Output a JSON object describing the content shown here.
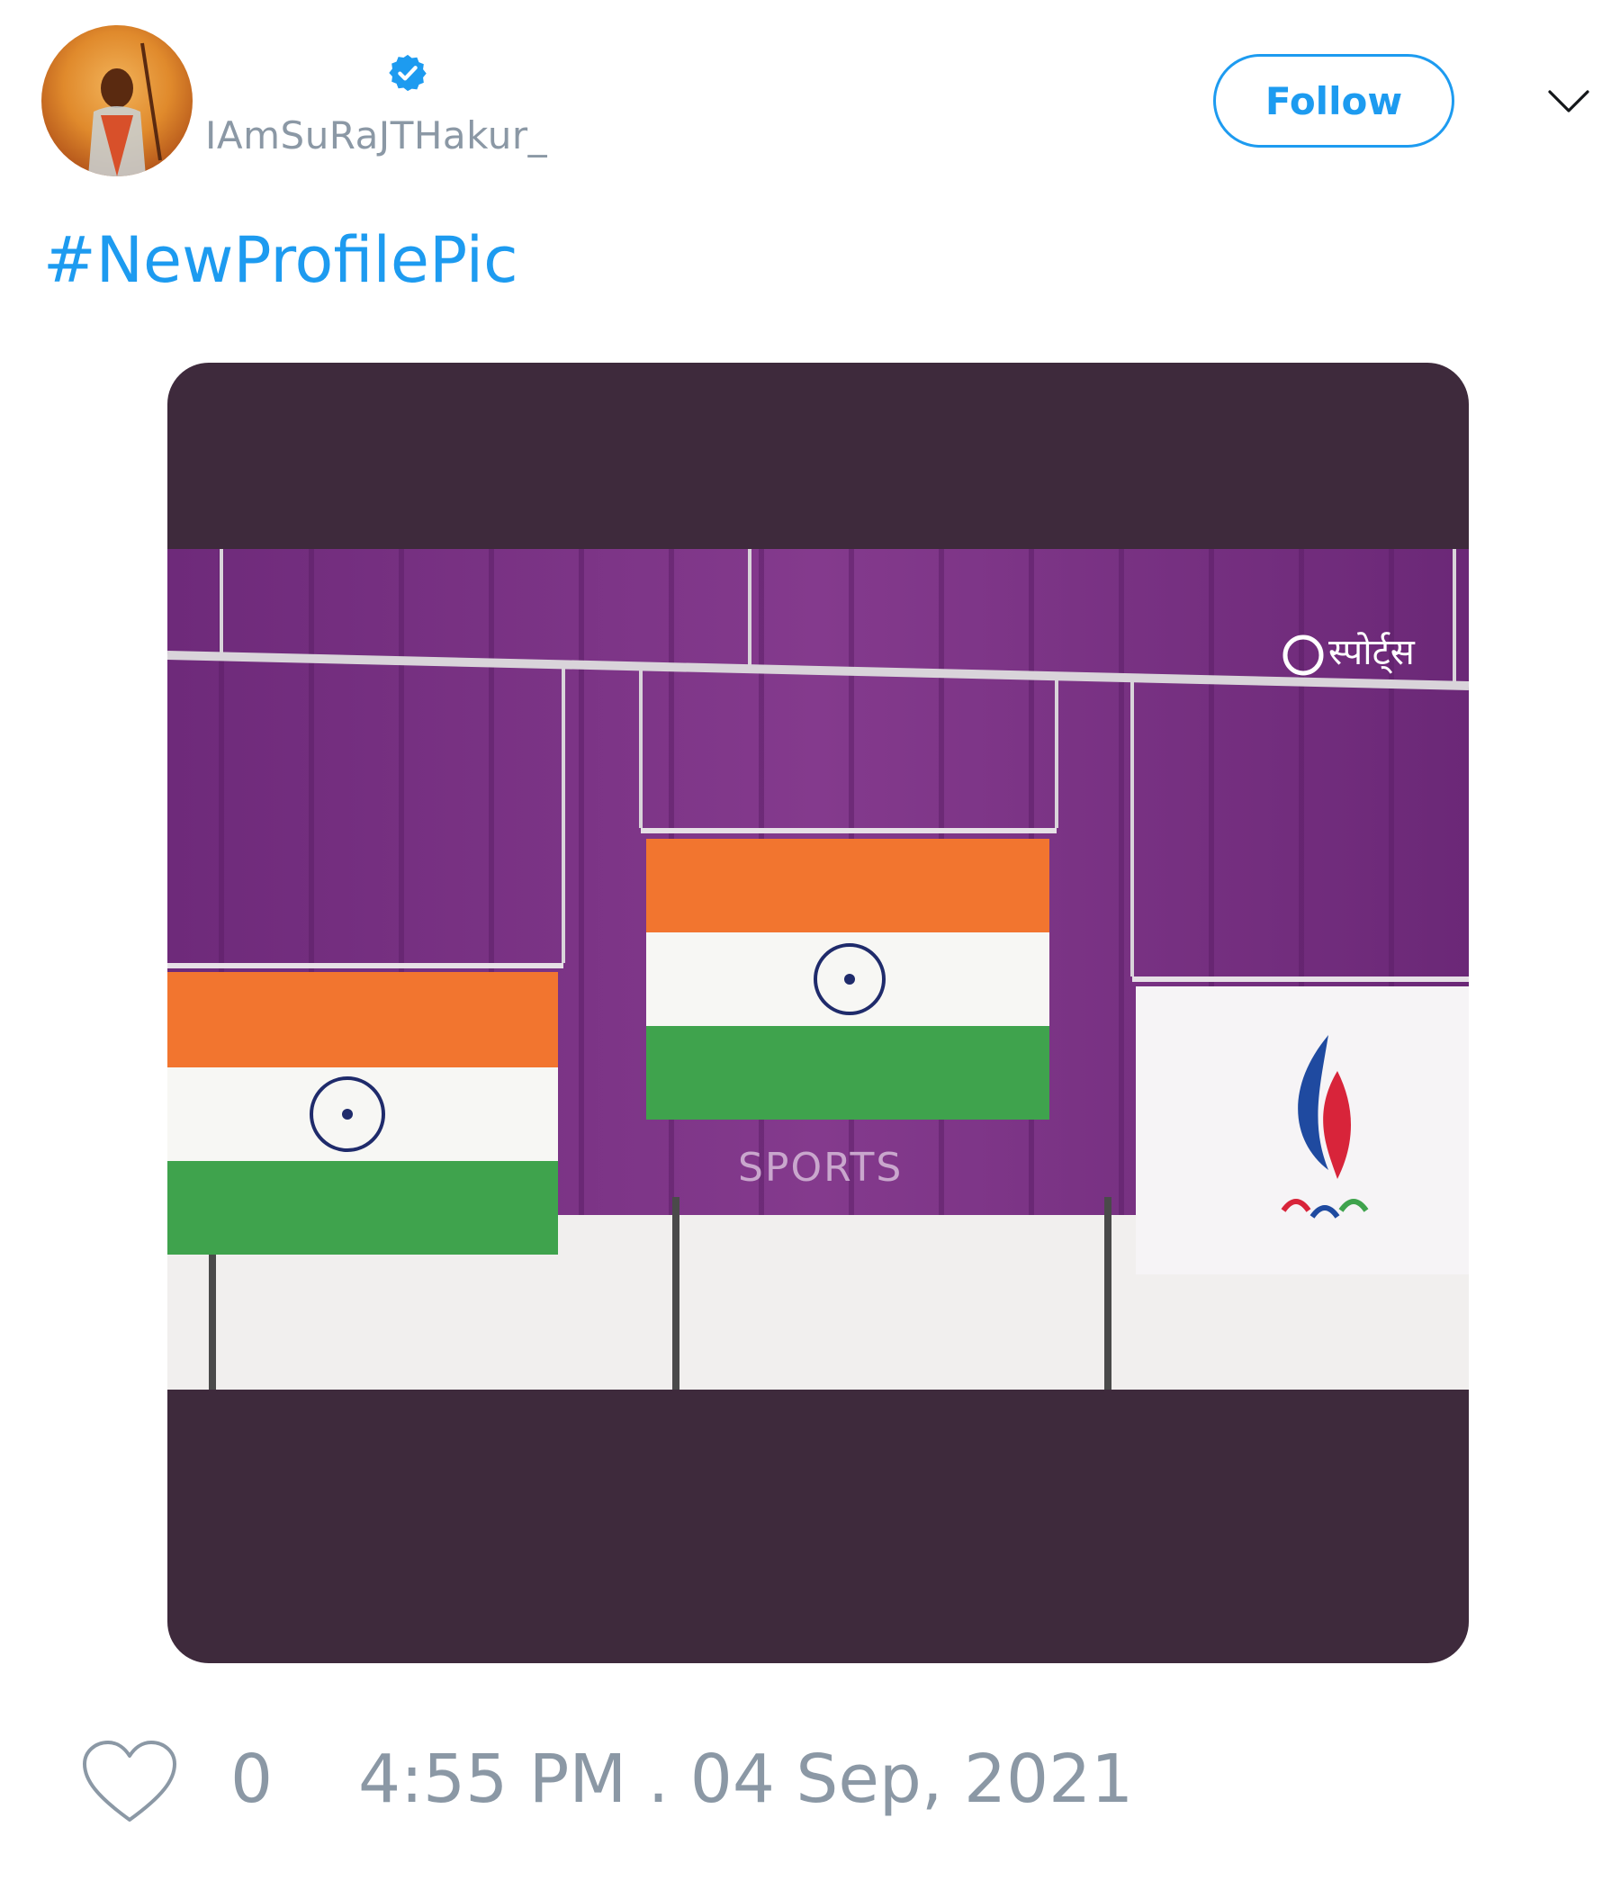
{
  "author": {
    "display_name": "",
    "handle": "IAmSuRaJTHakur_",
    "verified": true,
    "avatar_icon": "profile-avatar"
  },
  "follow_button": {
    "label": "Follow"
  },
  "menu_icon": "chevron-down-icon",
  "tweet": {
    "text": "#NewProfilePic"
  },
  "media": {
    "watermark_text": "SPORTS",
    "channel_logo_text": "स्पोर्ट्स"
  },
  "footer": {
    "like_icon": "heart-icon",
    "like_count": "0",
    "timestamp": "4:55 PM . 04 Sep, 2021"
  },
  "colors": {
    "accent": "#1d9bf0",
    "muted_text": "#8b98a5",
    "media_background": "#3e2a3c",
    "curtain_purple": "#7a2f82",
    "saffron": "#f2752f",
    "green": "#3fa34d"
  }
}
